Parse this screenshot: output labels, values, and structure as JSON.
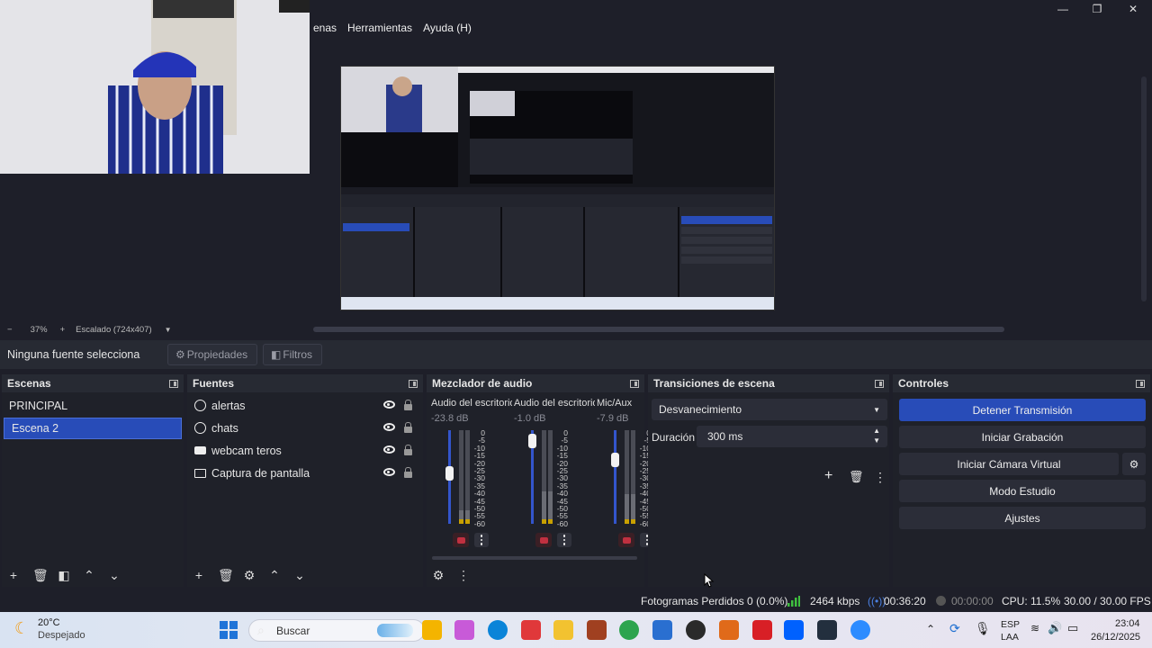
{
  "menu": [
    "enas",
    "Herramientas",
    "Ayuda (H)"
  ],
  "window_controls": {
    "minimize": "—",
    "maximize": "❐",
    "close": "✕"
  },
  "zoom": {
    "minus": "−",
    "level": "37%",
    "plus": "+",
    "mode": "Escalado (724x407)"
  },
  "properties_bar": {
    "no_source": "Ninguna fuente selecciona",
    "properties": "Propiedades",
    "filters": "Filtros"
  },
  "scenes": {
    "title": "Escenas",
    "items": [
      "PRINCIPAL",
      "Escena 2"
    ],
    "selected": 1
  },
  "sources": {
    "title": "Fuentes",
    "items": [
      {
        "name": "alertas",
        "icon": "globe-icon"
      },
      {
        "name": "chats",
        "icon": "globe-icon"
      },
      {
        "name": "webcam teros",
        "icon": "camera-icon"
      },
      {
        "name": "Captura de pantalla",
        "icon": "monitor-icon"
      }
    ]
  },
  "mixer": {
    "title": "Mezclador de audio",
    "channels": [
      {
        "name": "Audio del escritorio",
        "db": "-23.8 dB",
        "fader": 0.55,
        "level": 0.14
      },
      {
        "name": "Audio del escritorio",
        "db": "-1.0 dB",
        "fader": 0.95,
        "level": 0.35
      },
      {
        "name": "Mic/Aux",
        "db": "-7.9 dB",
        "fader": 0.72,
        "level": 0.32
      }
    ],
    "scale": [
      "0",
      "-5",
      "-10",
      "-15",
      "-20",
      "-25",
      "-30",
      "-35",
      "-40",
      "-45",
      "-50",
      "-55",
      "-60"
    ]
  },
  "transitions": {
    "title": "Transiciones de escena",
    "type": "Desvanecimiento",
    "duration_label": "Duración",
    "duration": "300 ms"
  },
  "controls": {
    "title": "Controles",
    "buttons": [
      "Detener Transmisión",
      "Iniciar Grabación",
      "Iniciar Cámara Virtual",
      "Modo Estudio",
      "Ajustes"
    ]
  },
  "status": {
    "dropped": "Fotogramas Perdidos 0 (0.0%)",
    "bitrate": "2464 kbps",
    "stream_time": "00:36:20",
    "rec_time": "00:00:00",
    "cpu": "CPU: 11.5%",
    "fps": "30.00 / 30.00 FPS"
  },
  "taskbar": {
    "weather_temp": "20°C",
    "weather_desc": "Despejado",
    "search": "Buscar",
    "lang1": "ESP",
    "lang2": "LAA",
    "time": "23:04",
    "date": "26/12/2025"
  },
  "colors": {
    "accent": "#284cb8",
    "panel": "#272a33",
    "bg": "#1e1f29",
    "mute": "#c03040"
  }
}
